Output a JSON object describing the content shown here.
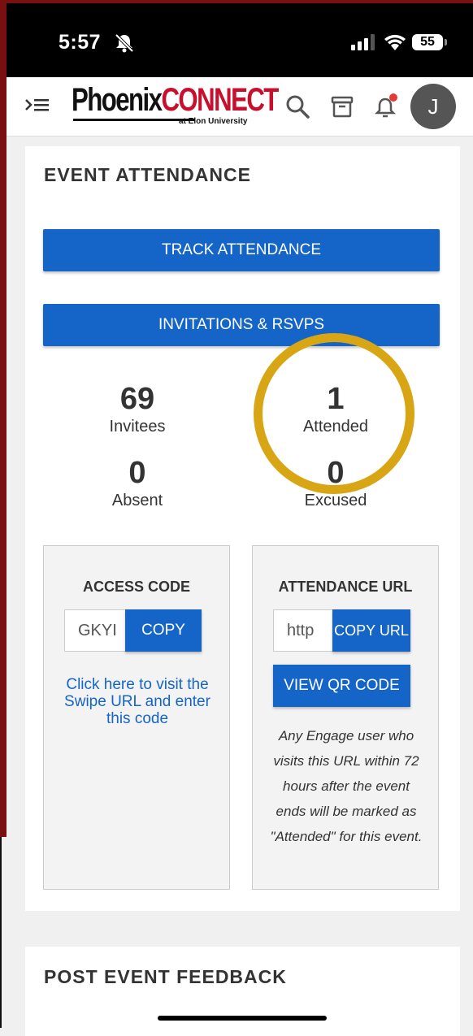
{
  "status_bar": {
    "time": "5:57",
    "battery": "55"
  },
  "app_bar": {
    "logo_main_1": "Phoenix",
    "logo_main_2": "CONNECT",
    "logo_sub": "at Elon University",
    "avatar_initial": "J",
    "notification_dot_color": "#e53935"
  },
  "attendance": {
    "title": "EVENT ATTENDANCE",
    "track_button": "TRACK ATTENDANCE",
    "invitations_button": "INVITATIONS & RSVPS",
    "stats": [
      {
        "value": "69",
        "label": "Invitees"
      },
      {
        "value": "1",
        "label": "Attended"
      },
      {
        "value": "0",
        "label": "Absent"
      },
      {
        "value": "0",
        "label": "Excused"
      }
    ],
    "access_code": {
      "title": "ACCESS CODE",
      "value": "GKYI",
      "copy_button": "COPY",
      "link_text": "Click here to visit the Swipe URL and enter this code"
    },
    "attendance_url": {
      "title": "ATTENDANCE URL",
      "value": "http",
      "copy_button": "COPY URL",
      "qr_button": "VIEW QR CODE",
      "note": "Any Engage user who visits this URL within 72 hours after the event ends will be marked as \"Attended\" for this event."
    }
  },
  "feedback": {
    "title": "POST EVENT FEEDBACK"
  },
  "colors": {
    "primary": "#1565c8",
    "highlight_ring": "#d8a515",
    "brand_red": "#c8102e"
  }
}
